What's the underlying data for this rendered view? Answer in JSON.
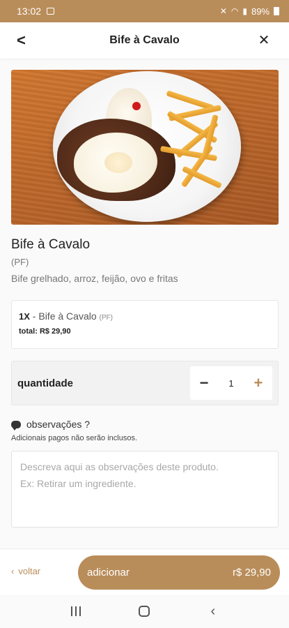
{
  "status_bar": {
    "time": "13:02",
    "battery": "89%"
  },
  "header": {
    "title": "Bife à Cavalo"
  },
  "product": {
    "name": "Bife à Cavalo",
    "tag": "(PF)",
    "description": "Bife grelhado, arroz, feijão, ovo e fritas"
  },
  "summary": {
    "qty": "1X",
    "separator": " - ",
    "item_name": "Bife à Cavalo",
    "item_tag": "(PF)",
    "total": "total: R$ 29,90"
  },
  "quantity": {
    "label": "quantidade",
    "value": "1",
    "minus": "−",
    "plus": "+"
  },
  "observations": {
    "title": "observações ?",
    "subtitle": "Adicionais pagos não serão inclusos.",
    "placeholder": "Descreva aqui as observações deste produto.\nEx: Retirar um ingrediente."
  },
  "footer": {
    "back_label": "voltar",
    "add_label": "adicionar",
    "add_price": "r$ 29,90"
  },
  "colors": {
    "accent": "#b98d5a"
  }
}
